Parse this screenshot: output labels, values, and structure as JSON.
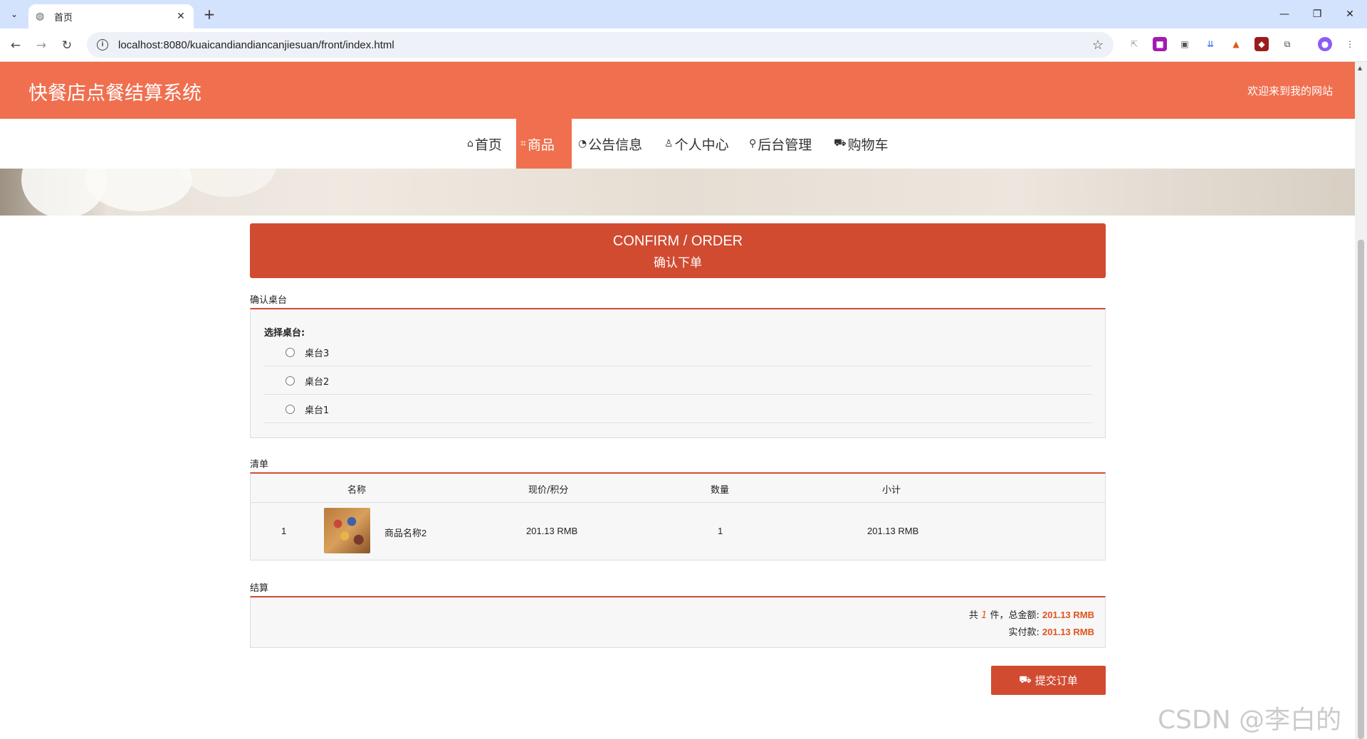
{
  "browser": {
    "tab_title": "首页",
    "tab_close": "✕",
    "new_tab": "+",
    "url": "localhost:8080/kuaicandiandiancanjiesuan/front/index.html",
    "win_minimize": "—",
    "win_restore": "❐",
    "win_close": "✕"
  },
  "site": {
    "title": "快餐店点餐结算系统",
    "welcome": "欢迎来到我的网站",
    "nav": [
      {
        "label": "首页",
        "icon": "home-icon",
        "glyph": "⌂"
      },
      {
        "label": "商品",
        "icon": "tag-icon",
        "glyph": "⌗"
      },
      {
        "label": "公告信息",
        "icon": "announce-icon",
        "glyph": "◔"
      },
      {
        "label": "个人中心",
        "icon": "user-icon",
        "glyph": "♙"
      },
      {
        "label": "后台管理",
        "icon": "link-icon",
        "glyph": "⚲"
      },
      {
        "label": "购物车",
        "icon": "cart-icon",
        "glyph": "⛟"
      }
    ]
  },
  "confirm": {
    "en": "CONFIRM / ORDER",
    "cn": "确认下单"
  },
  "table_section": {
    "label": "确认桌台",
    "choose": "选择桌台:",
    "options": [
      "桌台3",
      "桌台2",
      "桌台1"
    ]
  },
  "list_section": {
    "label": "清单",
    "headers": {
      "name": "名称",
      "price": "现价/积分",
      "qty": "数量",
      "subtotal": "小计"
    },
    "rows": [
      {
        "index": "1",
        "name": "商品名称2",
        "price": "201.13 RMB",
        "qty": "1",
        "subtotal": "201.13 RMB"
      }
    ]
  },
  "settle_section": {
    "label": "结算",
    "line1_prefix": "共",
    "count": "1",
    "line1_mid": "件，总金额:",
    "total": "201.13 RMB",
    "line2_prefix": "实付款:",
    "paid": "201.13 RMB"
  },
  "submit_label": "提交订单",
  "watermark": "CSDN @李白的粉",
  "colors": {
    "brand": "#f06f4f",
    "accent": "#d14b31",
    "price": "#e0531f"
  }
}
